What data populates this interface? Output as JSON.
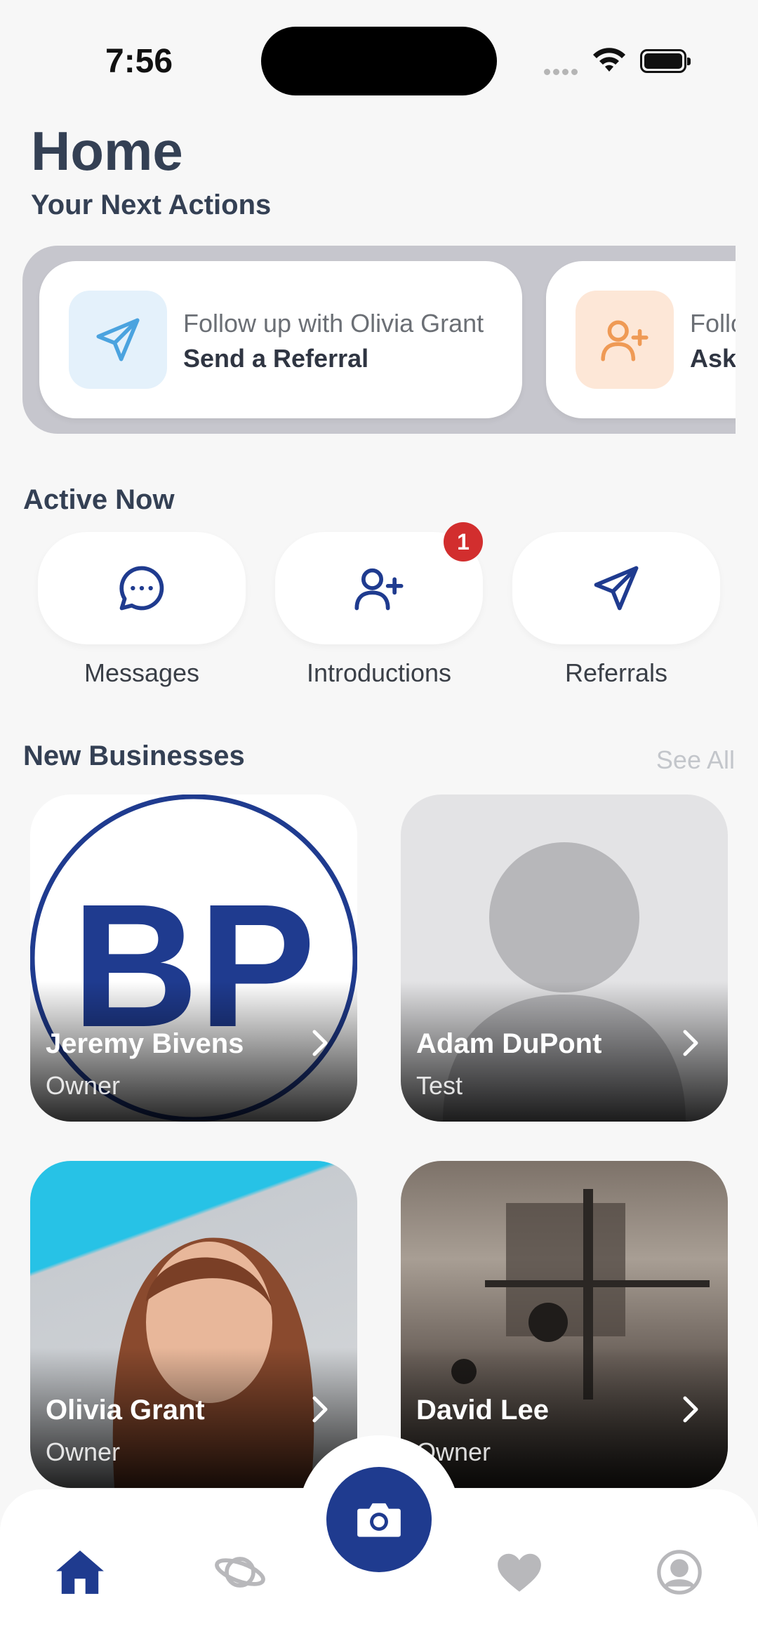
{
  "status": {
    "time": "7:56"
  },
  "header": {
    "title": "Home",
    "subtitle": "Your Next Actions"
  },
  "actions": [
    {
      "line1": "Follow up with Olivia Grant",
      "line2": "Send a Referral",
      "icon": "send-icon"
    },
    {
      "line1": "Follo",
      "line2": "Ask",
      "icon": "user-plus-icon"
    }
  ],
  "active": {
    "title": "Active Now",
    "items": [
      {
        "label": "Messages",
        "icon": "chat-bubble-icon"
      },
      {
        "label": "Introductions",
        "icon": "user-plus-icon",
        "badge": "1"
      },
      {
        "label": "Referrals",
        "icon": "send-icon"
      }
    ]
  },
  "businesses": {
    "title": "New Businesses",
    "see_all": "See All",
    "items": [
      {
        "name": "Jeremy Bivens",
        "role": "Owner",
        "logo_text": "BP"
      },
      {
        "name": "Adam DuPont",
        "role": "Test"
      },
      {
        "name": "Olivia Grant",
        "role": "Owner"
      },
      {
        "name": "David Lee",
        "role": "Owner"
      }
    ]
  },
  "tabs": [
    "home-icon",
    "planet-icon",
    "camera-icon",
    "heart-icon",
    "profile-icon"
  ],
  "colors": {
    "primary": "#1f3b8f",
    "badge": "#d22e2e",
    "accent_blue": "#4ba3df",
    "accent_orange": "#ef9a55"
  }
}
